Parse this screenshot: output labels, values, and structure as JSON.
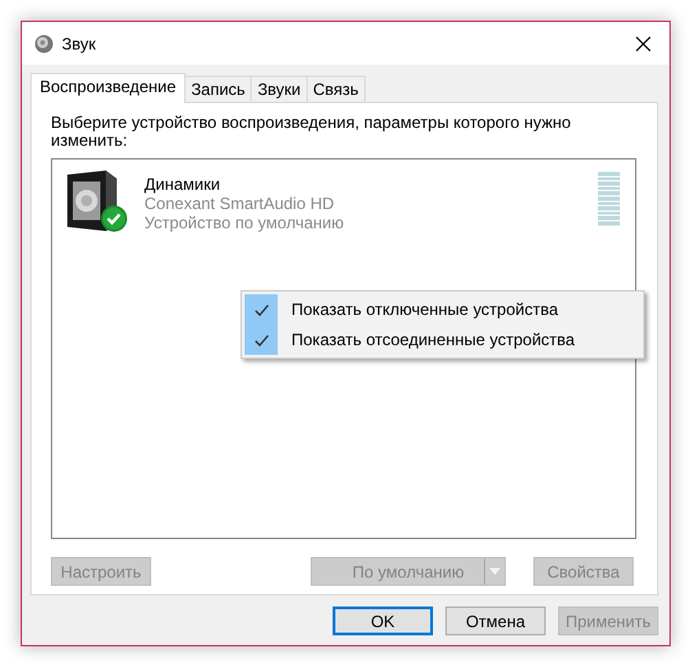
{
  "window": {
    "title": "Звук"
  },
  "tabs": [
    {
      "label": "Воспроизведение",
      "selected": true
    },
    {
      "label": "Запись",
      "selected": false
    },
    {
      "label": "Звуки",
      "selected": false
    },
    {
      "label": "Связь",
      "selected": false
    }
  ],
  "instruction": "Выберите устройство воспроизведения, параметры которого нужно изменить:",
  "devices": [
    {
      "name": "Динамики",
      "driver": "Conexant SmartAudio HD",
      "status": "Устройство по умолчанию",
      "is_default": true,
      "selected": false
    }
  ],
  "context_menu": [
    {
      "label": "Показать отключенные устройства",
      "checked": true
    },
    {
      "label": "Показать отсоединенные устройства",
      "checked": true
    }
  ],
  "device_buttons": [
    {
      "kind": "button",
      "label": "Настроить",
      "disabled": true
    },
    {
      "kind": "split",
      "label": "По умолчанию",
      "disabled": true
    },
    {
      "kind": "button",
      "label": "Свойства",
      "disabled": true
    }
  ],
  "dialog_buttons": [
    {
      "label": "OK",
      "disabled": false,
      "default": true
    },
    {
      "label": "Отмена",
      "disabled": false,
      "default": false
    },
    {
      "label": "Применить",
      "disabled": true,
      "default": false
    }
  ]
}
